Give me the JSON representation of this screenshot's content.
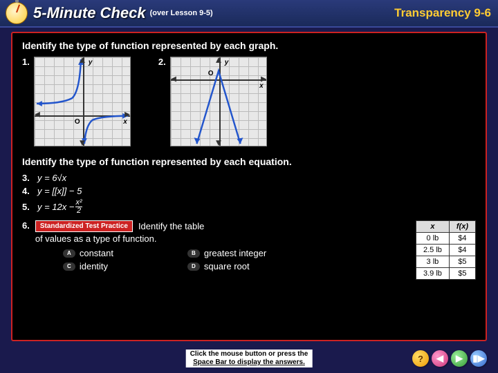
{
  "header": {
    "title": "5-Minute Check",
    "lesson_ref": "(over Lesson 9-5)",
    "transparency": "Transparency 9-6"
  },
  "content": {
    "instr_graph": "Identify the type of function represented by each graph.",
    "q1_num": "1.",
    "q2_num": "2.",
    "graph1": {
      "y_label": "y",
      "x_label": "x",
      "origin": "O"
    },
    "graph2": {
      "y_label": "y",
      "x_label": "x",
      "origin": "O"
    },
    "instr_eq": "Identify the type of function represented by  each equation.",
    "q3_num": "3.",
    "q3_eq": "y = 6√x",
    "q4_num": "4.",
    "q4_eq": "y = [[x]] − 5",
    "q5_num": "5.",
    "q5_eq_a": "y = 12x − ",
    "q5_eq_frac_top": "x²",
    "q5_eq_frac_bot": "2",
    "q6_num": "6.",
    "q6_badge": "Standardized Test Practice",
    "q6_text_a": "Identify the table",
    "q6_text_b": "of values as a type of function.",
    "table": {
      "headers": [
        "x",
        "f(x)"
      ],
      "rows": [
        [
          "0 lb",
          "$4"
        ],
        [
          "2.5 lb",
          "$4"
        ],
        [
          "3 lb",
          "$5"
        ],
        [
          "3.9 lb",
          "$5"
        ]
      ]
    },
    "choices": {
      "a": {
        "marker": "A",
        "label": "constant"
      },
      "b": {
        "marker": "B",
        "label": "greatest integer"
      },
      "c": {
        "marker": "C",
        "label": "identity"
      },
      "d": {
        "marker": "D",
        "label": "square root"
      }
    }
  },
  "footer": {
    "line1": "Click the mouse button or press the",
    "line2": "Space Bar to display the answers."
  },
  "nav": {
    "help": "?",
    "back": "◀",
    "fwd": "▶",
    "end": "▮▶"
  }
}
